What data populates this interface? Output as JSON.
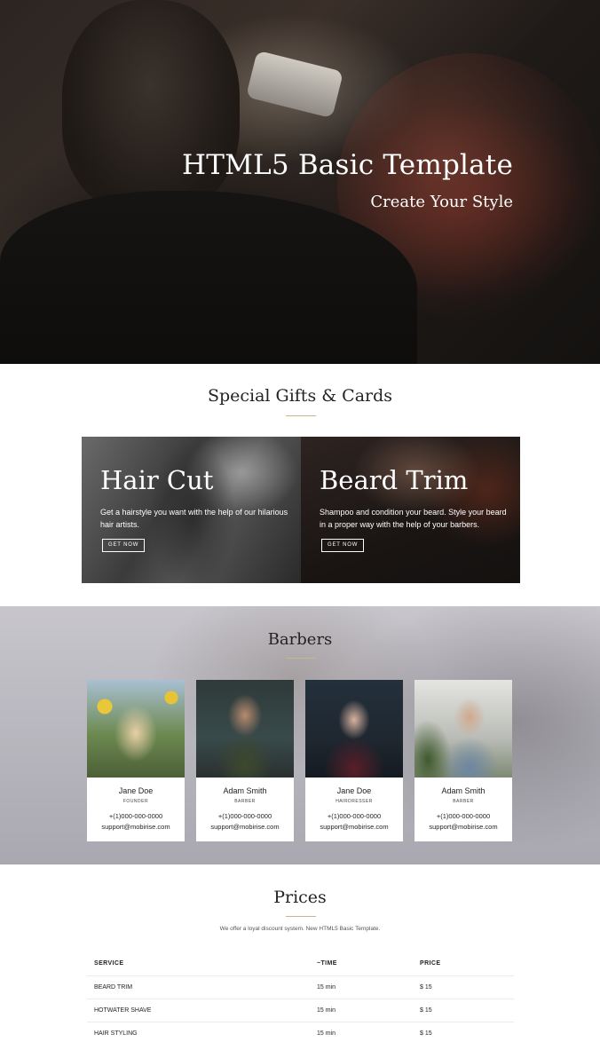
{
  "hero": {
    "title": "HTML5 Basic Template",
    "subtitle": "Create Your Style"
  },
  "gifts": {
    "title": "Special Gifts & Cards",
    "cards": [
      {
        "title": "Hair Cut",
        "text": "Get a hairstyle you want with the help of our hilarious hair artists.",
        "button": "GET NOW"
      },
      {
        "title": "Beard Trim",
        "text": "Shampoo and condition your beard. Style your beard in a proper way with the help of your barbers.",
        "button": "GET NOW"
      }
    ]
  },
  "barbers": {
    "title": "Barbers",
    "members": [
      {
        "name": "Jane Doe",
        "role": "FOUNDER",
        "phone": "+(1)000-000-0000",
        "email": "support@mobirise.com"
      },
      {
        "name": "Adam Smith",
        "role": "BARBER",
        "phone": "+(1)000-000-0000",
        "email": "support@mobirise.com"
      },
      {
        "name": "Jane Doe",
        "role": "HAIRDRESSER",
        "phone": "+(1)000-000-0000",
        "email": "support@mobirise.com"
      },
      {
        "name": "Adam Smith",
        "role": "BARBER",
        "phone": "+(1)000-000-0000",
        "email": "support@mobirise.com"
      }
    ]
  },
  "prices": {
    "title": "Prices",
    "description": "We offer a loyal discount system. New HTML5 Basic Template.",
    "headers": [
      "SERVICE",
      "~TIME",
      "PRICE"
    ],
    "rows": [
      [
        "BEARD TRIM",
        "15 min",
        "$ 15"
      ],
      [
        "HOTWATER SHAVE",
        "15 min",
        "$ 15"
      ],
      [
        "HAIR STYLING",
        "15 min",
        "$ 15"
      ]
    ]
  },
  "colors": {
    "accent": "#c9b58a",
    "text": "#232323"
  }
}
